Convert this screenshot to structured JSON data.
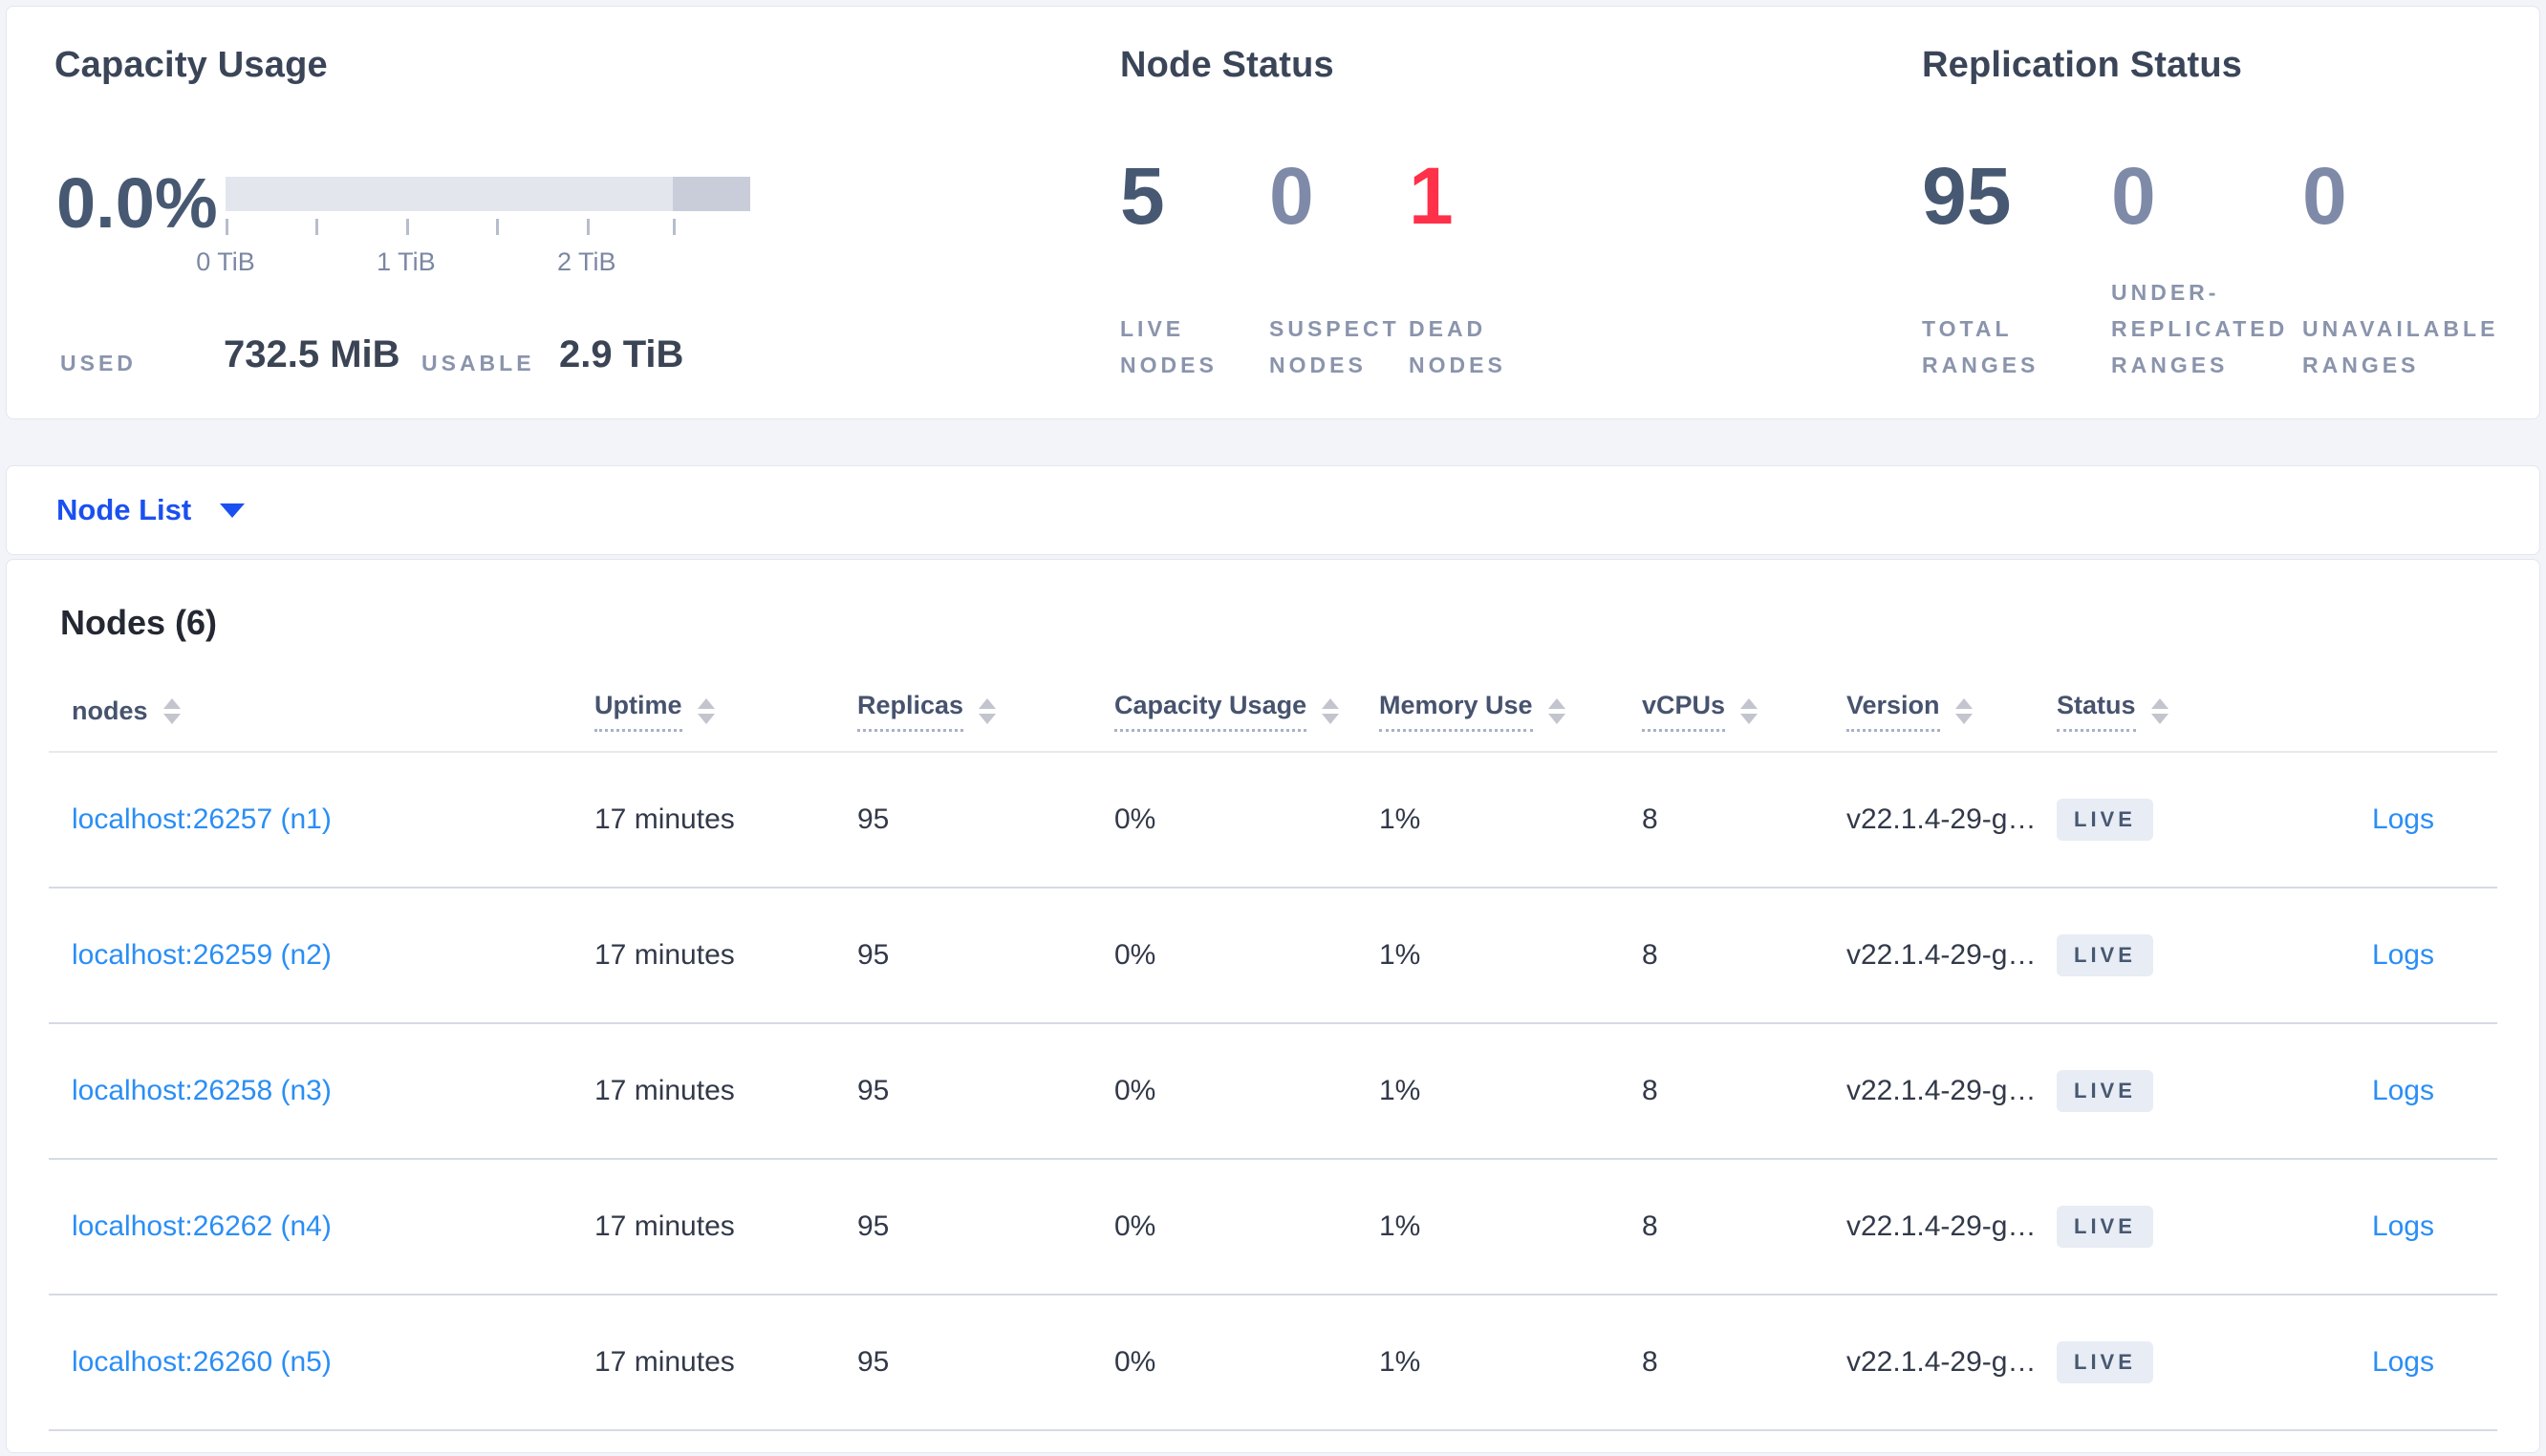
{
  "colors": {
    "accent_blue": "#1b50f0",
    "link_blue": "#2a8ef5",
    "danger_red": "#ff3049",
    "dark_slate": "#475872",
    "muted_slate": "#7e8aa8",
    "badge_bg": "#e8ecf4"
  },
  "summary": {
    "capacity": {
      "title": "Capacity Usage",
      "percent": "0.0%",
      "ticks": [
        "0 TiB",
        "1 TiB",
        "2 TiB"
      ],
      "bar": {
        "light_color": "#e4e6ee",
        "dark_color": "#c9cdd9",
        "dark_segment_start_fraction": 0.852,
        "used_fill_fraction": 0.0
      },
      "used_label": "USED",
      "used_value": "732.5 MiB",
      "usable_label": "USABLE",
      "usable_value": "2.9 TiB"
    },
    "node_status": {
      "title": "Node Status",
      "stats": [
        {
          "name": "live-nodes",
          "value": "5",
          "label": "LIVE NODES",
          "tone": "dark"
        },
        {
          "name": "suspect-nodes",
          "value": "0",
          "label": "SUSPECT NODES",
          "tone": "muted"
        },
        {
          "name": "dead-nodes",
          "value": "1",
          "label": "DEAD NODES",
          "tone": "danger"
        }
      ]
    },
    "replication": {
      "title": "Replication Status",
      "stats": [
        {
          "name": "total-ranges",
          "value": "95",
          "label": "TOTAL RANGES",
          "tone": "dark"
        },
        {
          "name": "under-replicated-ranges",
          "value": "0",
          "label": "UNDER-REPLICATED RANGES",
          "tone": "muted"
        },
        {
          "name": "unavailable-ranges",
          "value": "0",
          "label": "UNAVAILABLE RANGES",
          "tone": "muted"
        }
      ]
    }
  },
  "node_list": {
    "label": "Node List",
    "caret_icon": "chevron-down-icon"
  },
  "nodes_section": {
    "heading": "Nodes (6)",
    "columns": [
      {
        "label": "nodes",
        "underlined": false
      },
      {
        "label": "Uptime",
        "underlined": true
      },
      {
        "label": "Replicas",
        "underlined": true
      },
      {
        "label": "Capacity Usage",
        "underlined": true
      },
      {
        "label": "Memory Use",
        "underlined": true
      },
      {
        "label": "vCPUs",
        "underlined": true
      },
      {
        "label": "Version",
        "underlined": true
      },
      {
        "label": "Status",
        "underlined": true
      }
    ],
    "sort_icon": "sort-arrows-icon",
    "rows": [
      {
        "node": "localhost:26257 (n1)",
        "uptime": "17 minutes",
        "replicas": "95",
        "capacity": "0%",
        "memory": "1%",
        "vcpus": "8",
        "version": "v22.1.4-29-g…",
        "status": "LIVE",
        "logs": "Logs"
      },
      {
        "node": "localhost:26259 (n2)",
        "uptime": "17 minutes",
        "replicas": "95",
        "capacity": "0%",
        "memory": "1%",
        "vcpus": "8",
        "version": "v22.1.4-29-g…",
        "status": "LIVE",
        "logs": "Logs"
      },
      {
        "node": "localhost:26258 (n3)",
        "uptime": "17 minutes",
        "replicas": "95",
        "capacity": "0%",
        "memory": "1%",
        "vcpus": "8",
        "version": "v22.1.4-29-g…",
        "status": "LIVE",
        "logs": "Logs"
      },
      {
        "node": "localhost:26262 (n4)",
        "uptime": "17 minutes",
        "replicas": "95",
        "capacity": "0%",
        "memory": "1%",
        "vcpus": "8",
        "version": "v22.1.4-29-g…",
        "status": "LIVE",
        "logs": "Logs"
      },
      {
        "node": "localhost:26260 (n5)",
        "uptime": "17 minutes",
        "replicas": "95",
        "capacity": "0%",
        "memory": "1%",
        "vcpus": "8",
        "version": "v22.1.4-29-g…",
        "status": "LIVE",
        "logs": "Logs"
      }
    ]
  }
}
